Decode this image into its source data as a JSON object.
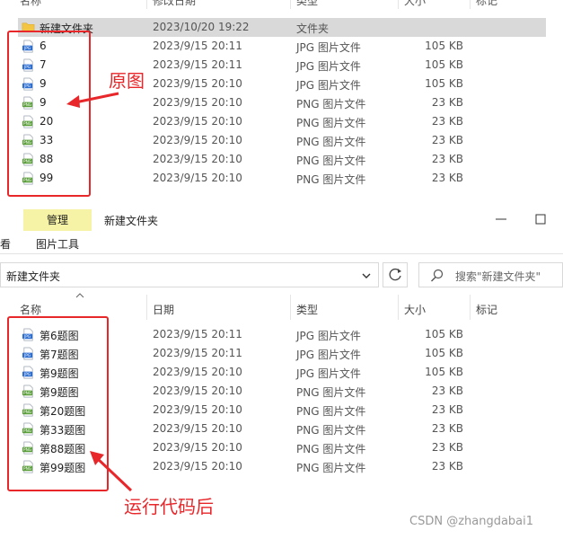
{
  "top_window": {
    "columns": [
      "名称",
      "修改日期",
      "类型",
      "大小",
      "标记"
    ],
    "rows": [
      {
        "name": "新建文件夹",
        "date": "2023/10/20 19:22",
        "type": "文件夹",
        "size": "",
        "icon": "folder-icon",
        "selected": true
      },
      {
        "name": "6",
        "date": "2023/9/15 20:11",
        "type": "JPG 图片文件",
        "size": "105 KB",
        "icon": "jpg-file-icon"
      },
      {
        "name": "7",
        "date": "2023/9/15 20:11",
        "type": "JPG 图片文件",
        "size": "105 KB",
        "icon": "jpg-file-icon"
      },
      {
        "name": "9",
        "date": "2023/9/15 20:10",
        "type": "JPG 图片文件",
        "size": "105 KB",
        "icon": "jpg-file-icon"
      },
      {
        "name": "9",
        "date": "2023/9/15 20:10",
        "type": "PNG 图片文件",
        "size": "23 KB",
        "icon": "png-file-icon"
      },
      {
        "name": "20",
        "date": "2023/9/15 20:10",
        "type": "PNG 图片文件",
        "size": "23 KB",
        "icon": "png-file-icon"
      },
      {
        "name": "33",
        "date": "2023/9/15 20:10",
        "type": "PNG 图片文件",
        "size": "23 KB",
        "icon": "png-file-icon"
      },
      {
        "name": "88",
        "date": "2023/9/15 20:10",
        "type": "PNG 图片文件",
        "size": "23 KB",
        "icon": "png-file-icon"
      },
      {
        "name": "99",
        "date": "2023/9/15 20:10",
        "type": "PNG 图片文件",
        "size": "23 KB",
        "icon": "png-file-icon"
      }
    ],
    "annotation": "原图"
  },
  "bottom_window": {
    "ribbon_context_tab": "管理",
    "title": "新建文件夹",
    "tabs": [
      "看",
      "图片工具"
    ],
    "address": "新建文件夹",
    "search_placeholder": "搜索\"新建文件夹\"",
    "columns": [
      "名称",
      "日期",
      "类型",
      "大小",
      "标记"
    ],
    "rows": [
      {
        "name": "第6题图",
        "date": "2023/9/15 20:11",
        "type": "JPG 图片文件",
        "size": "105 KB",
        "icon": "jpg-file-icon"
      },
      {
        "name": "第7题图",
        "date": "2023/9/15 20:11",
        "type": "JPG 图片文件",
        "size": "105 KB",
        "icon": "jpg-file-icon"
      },
      {
        "name": "第9题图",
        "date": "2023/9/15 20:10",
        "type": "JPG 图片文件",
        "size": "105 KB",
        "icon": "jpg-file-icon"
      },
      {
        "name": "第9题图",
        "date": "2023/9/15 20:10",
        "type": "PNG 图片文件",
        "size": "23 KB",
        "icon": "png-file-icon"
      },
      {
        "name": "第20题图",
        "date": "2023/9/15 20:10",
        "type": "PNG 图片文件",
        "size": "23 KB",
        "icon": "png-file-icon"
      },
      {
        "name": "第33题图",
        "date": "2023/9/15 20:10",
        "type": "PNG 图片文件",
        "size": "23 KB",
        "icon": "png-file-icon"
      },
      {
        "name": "第88题图",
        "date": "2023/9/15 20:10",
        "type": "PNG 图片文件",
        "size": "23 KB",
        "icon": "png-file-icon"
      },
      {
        "name": "第99题图",
        "date": "2023/9/15 20:10",
        "type": "PNG 图片文件",
        "size": "23 KB",
        "icon": "png-file-icon"
      }
    ],
    "annotation": "运行代码后"
  },
  "watermark": "CSDN @zhangdabai1",
  "colors": {
    "annotation_red": "#e8272b",
    "selected_row": "#d9d9d9",
    "ribbon_highlight": "#f7f3a6"
  }
}
